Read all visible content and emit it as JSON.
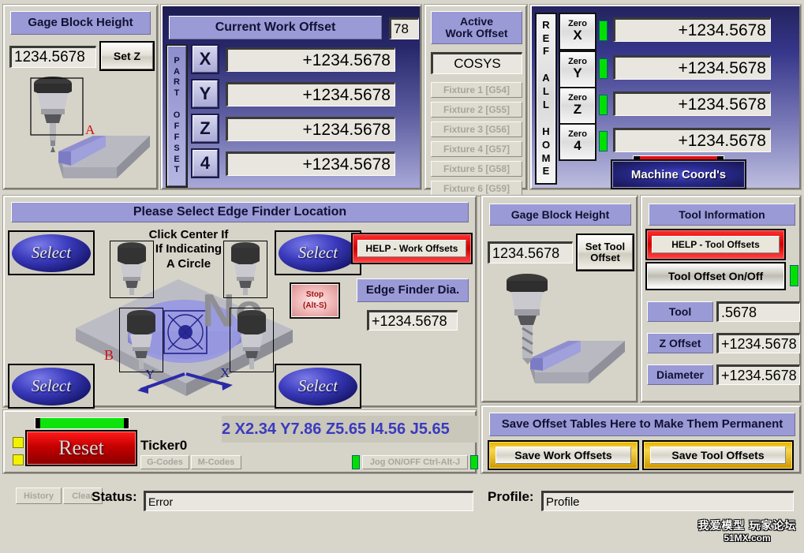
{
  "gage_block_left": {
    "title": "Gage Block Height",
    "value": "1234.5678",
    "set_button": "Set Z"
  },
  "current_work_offset": {
    "title": "Current Work Offset",
    "corner_value": "78",
    "side_label": "PART OFFSET",
    "axes": [
      {
        "key": "X",
        "value": "+1234.5678"
      },
      {
        "key": "Y",
        "value": "+1234.5678"
      },
      {
        "key": "Z",
        "value": "+1234.5678"
      },
      {
        "key": "4",
        "value": "+1234.5678"
      }
    ]
  },
  "active_work_offset": {
    "title": "Active\nWork Offset",
    "title_line1": "Active",
    "title_line2": "Work Offset",
    "cosys": "COSYS",
    "fixtures": [
      "Fixture 1 [G54]",
      "Fixture 2 [G55]",
      "Fixture 3 [G56]",
      "Fixture 4 [G57]",
      "Fixture 5 [G58]",
      "Fixture 6 [G59]"
    ]
  },
  "ref_panel": {
    "side_label": "REF ALL HOME",
    "rows": [
      {
        "zero_label": "Zero",
        "axis": "X",
        "value": "+1234.5678"
      },
      {
        "zero_label": "Zero",
        "axis": "Y",
        "value": "+1234.5678"
      },
      {
        "zero_label": "Zero",
        "axis": "Z",
        "value": "+1234.5678"
      },
      {
        "zero_label": "Zero",
        "axis": "4",
        "value": "+1234.5678"
      }
    ],
    "machine_coords_button": "Machine Coord's"
  },
  "edge_finder": {
    "title": "Please Select Edge Finder Location",
    "select_label": "Select",
    "hint_line1": "Click Center If",
    "hint_line2": "If Indicating",
    "hint_line3": "A Circle",
    "overlay_text": "No",
    "help_button": "HELP - Work Offsets",
    "stop_line1": "Stop",
    "stop_line2": "(Alt-S)",
    "dia_label": "Edge Finder Dia.",
    "dia_value": "+1234.5678",
    "axis_x": "X",
    "axis_y": "Y",
    "marker_b": "B"
  },
  "gage_block_right": {
    "title": "Gage Block Height",
    "value": "1234.5678",
    "set_button_line1": "Set Tool",
    "set_button_line2": "Offset"
  },
  "tool_information": {
    "title": "Tool Information",
    "help_button": "HELP - Tool Offsets",
    "onoff_button": "Tool Offset On/Off",
    "rows": [
      {
        "label": "Tool",
        "value": ".5678"
      },
      {
        "label": "Z Offset",
        "value": "+1234.5678"
      },
      {
        "label": "Diameter",
        "value": "+1234.5678"
      }
    ]
  },
  "ticker": {
    "reset_button": "Reset",
    "name": "Ticker0",
    "gcodes_button": "G-Codes",
    "mcodes_button": "M-Codes",
    "gcode_line": "2 X2.34 Y7.86 Z5.65 I4.56 J5.65",
    "jog_button": "Jog ON/OFF Ctrl-Alt-J"
  },
  "save_offsets": {
    "title": "Save Offset Tables Here to Make Them Permanent",
    "save_work_button": "Save Work Offsets",
    "save_tool_button": "Save Tool Offsets"
  },
  "status": {
    "history_button": "History",
    "clear_button": "Clear",
    "label": "Status:",
    "value": "Error"
  },
  "profile": {
    "label": "Profile:",
    "value": "Profile"
  },
  "watermark": {
    "line1": "我爱模型 玩家论坛",
    "line2": "51MX.com"
  },
  "colors": {
    "panel_bg": "#d6d3c8",
    "label_blue": "#9a9ad6",
    "dro_bg": "#e8e6de",
    "led_green": "#00e000",
    "alert_red": "#cf0000",
    "gold": "#e8b500",
    "gcode_text": "#3a3ac0"
  }
}
